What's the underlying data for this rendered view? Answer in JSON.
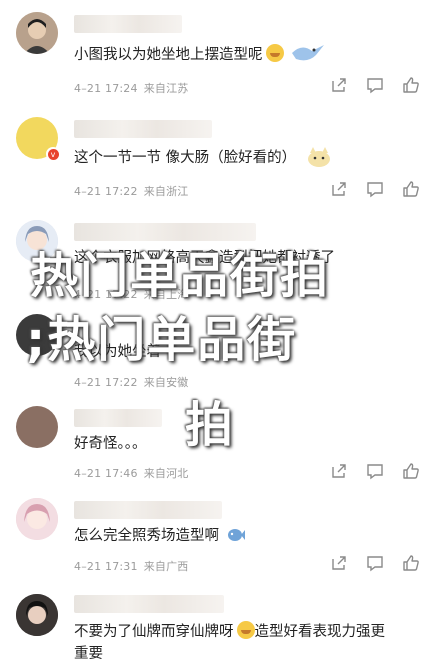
{
  "comments": [
    {
      "text": "小图我以为她坐地上摆造型呢",
      "time": "4–21 17:24",
      "location": "来自江苏",
      "avatar_color": "#d9c3ad"
    },
    {
      "text": "这个一节一节 像大肠（脸好看的）",
      "time": "4–21 17:22",
      "location": "来自浙江",
      "avatar_color": "#f2d85e"
    },
    {
      "text": "这个衣服加网格高天鑫造型把她都衬透了",
      "time": "4–21 17:22",
      "location": "来自上海",
      "avatar_color": "#cfd8e8"
    },
    {
      "text": "我以为她坐着",
      "time": "4–21 17:22",
      "location": "来自安徽",
      "avatar_color": "#3b3b3b"
    },
    {
      "text": "好奇怪。。。",
      "time": "4–21 17:46",
      "location": "来自河北",
      "avatar_color": "#8a6f63"
    },
    {
      "text": "怎么完全照秀场造型啊",
      "time": "4–21 17:31",
      "location": "来自广西",
      "avatar_color": "#e9c9cf"
    },
    {
      "text": "不要为了仙牌而穿仙牌呀",
      "text2": "造型好看表现力强更",
      "text_line2": "重要",
      "time": "",
      "location": "",
      "avatar_color": "#2b2b2b"
    }
  ],
  "overlay": {
    "line1": "热门单品街拍",
    "line2": ";热门单品街",
    "line3": "拍"
  },
  "icons": {
    "share": "share-icon",
    "comment": "comment-icon",
    "like": "thumbs-up-icon"
  }
}
